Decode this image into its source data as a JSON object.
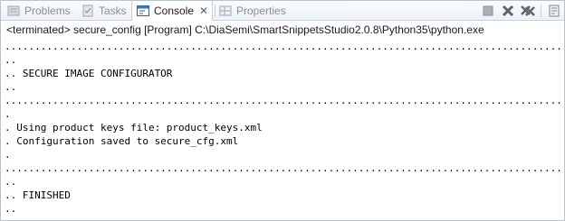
{
  "tabs": [
    {
      "label": "Problems",
      "icon": "problems-icon",
      "active": false
    },
    {
      "label": "Tasks",
      "icon": "tasks-icon",
      "active": false
    },
    {
      "label": "Console",
      "icon": "console-icon",
      "active": true
    },
    {
      "label": "Properties",
      "icon": "properties-icon",
      "active": false
    }
  ],
  "status": "<terminated> secure_config [Program] C:\\DiaSemi\\SmartSnippetsStudio2.0.8\\Python35\\python.exe",
  "console_lines": [
    "..........................................................................................................",
    "..",
    ".. SECURE IMAGE CONFIGURATOR",
    "..",
    "..........................................................................................................",
    ".",
    ". Using product keys file: product_keys.xml",
    ". Configuration saved to secure_cfg.xml",
    ".",
    "..........................................................................................................",
    "..",
    ".. FINISHED",
    ".."
  ],
  "toolbar_icons": [
    "terminate-icon",
    "remove-launch-icon",
    "remove-all-terminated-icon",
    "pin-console-icon",
    "display-selected-console-icon"
  ]
}
